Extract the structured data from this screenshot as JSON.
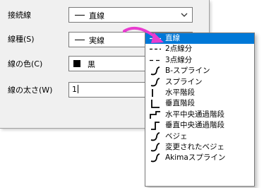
{
  "form": {
    "connection_label": "接続線",
    "connection_value": "直線",
    "line_type_label": "線種(S)",
    "line_type_value": "実線",
    "line_color_label": "線の色(C)",
    "line_color_value": "黒",
    "line_width_label": "線の太さ(W)",
    "line_width_value": "1"
  },
  "dropdown": {
    "selected_index": 0,
    "options": [
      {
        "label": "直線",
        "icon": "straight-line-icon"
      },
      {
        "label": "2点線分",
        "icon": "two-point-segment-icon"
      },
      {
        "label": "3点線分",
        "icon": "three-point-segment-icon"
      },
      {
        "label": "B-スプライン",
        "icon": "b-spline-icon"
      },
      {
        "label": "スプライン",
        "icon": "spline-icon"
      },
      {
        "label": "水平階段",
        "icon": "horizontal-step-icon"
      },
      {
        "label": "垂直階段",
        "icon": "vertical-step-icon"
      },
      {
        "label": "水平中央通過階段",
        "icon": "horizontal-center-step-icon"
      },
      {
        "label": "垂直中央通過階段",
        "icon": "vertical-center-step-icon"
      },
      {
        "label": "ベジェ",
        "icon": "bezier-icon"
      },
      {
        "label": "変更されたベジェ",
        "icon": "modified-bezier-icon"
      },
      {
        "label": "Akimaスプライン",
        "icon": "akima-spline-icon"
      }
    ]
  },
  "colors": {
    "selection": "#0078d7",
    "arrow": "#e83ccf"
  }
}
